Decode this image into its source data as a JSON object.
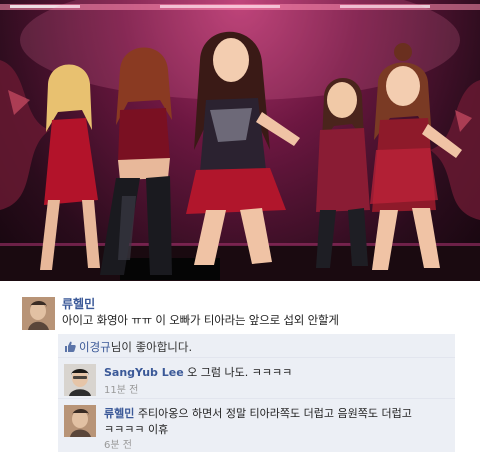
{
  "post": {
    "author": "류헬민",
    "text": "아이고 화영아 ㅠㅠ 이 오빠가 티아라는 앞으로 섭외 안할게"
  },
  "likes": {
    "name": "이경규",
    "suffix": "님이 좋아합니다."
  },
  "comments": [
    {
      "author": "SangYub Lee",
      "text": " 오 그럼 나도. ㅋㅋㅋㅋ",
      "time": "11분 전"
    },
    {
      "author": "류헬민",
      "text": " 주티아옹으 하면서 정말 티아라쪽도 더럽고 음원쪽도 더럽고",
      "text_line2": "ㅋㅋㅋㅋ 이휴",
      "time": "6분 전"
    }
  ],
  "colors": {
    "link": "#3b5998",
    "ufi_bg": "#eceff5",
    "stage_pink": "#b2386f"
  },
  "icons": {
    "like": "thumbs-up-icon"
  }
}
